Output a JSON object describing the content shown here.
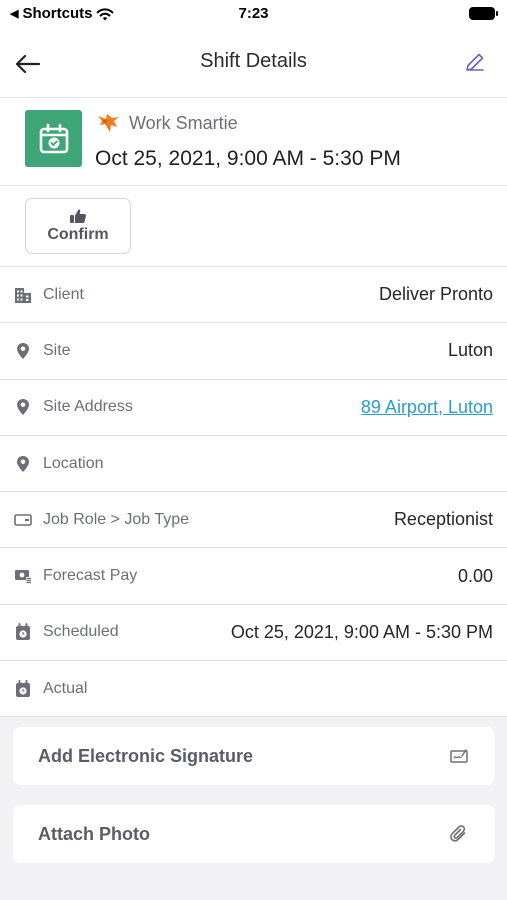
{
  "status_bar": {
    "back_app": "Shortcuts",
    "time": "7:23"
  },
  "nav": {
    "title": "Shift Details",
    "back_icon": "arrow-left-icon",
    "edit_icon": "pencil-icon"
  },
  "shift": {
    "organization": "Work Smartie",
    "time_range": "Oct 25, 2021, 9:00 AM - 5:30 PM",
    "accent_color": "#3ea676"
  },
  "confirm_button": {
    "label": "Confirm",
    "icon": "thumbs-up-icon"
  },
  "details": [
    {
      "label": "Client",
      "value": "Deliver Pronto",
      "icon": "building-icon"
    },
    {
      "label": "Site",
      "value": "Luton",
      "icon": "map-pin-icon"
    },
    {
      "label": "Site Address",
      "value": "89 Airport, Luton",
      "icon": "map-pin-icon"
    },
    {
      "label": "Location",
      "value": "",
      "icon": "map-pin-icon"
    },
    {
      "label": "Job Role > Job Type",
      "value": "Receptionist",
      "icon": "badge-icon"
    },
    {
      "label": "Forecast Pay",
      "value": "0.00",
      "icon": "money-icon"
    },
    {
      "label": "Scheduled",
      "value": "Oct 25, 2021, 9:00 AM - 5:30 PM",
      "icon": "calendar-clock-icon"
    },
    {
      "label": "Actual",
      "value": "",
      "icon": "calendar-clock-icon"
    }
  ],
  "actions": {
    "signature": {
      "label": "Add Electronic Signature",
      "icon": "signature-icon"
    },
    "photo": {
      "label": "Attach Photo",
      "icon": "paperclip-icon"
    }
  },
  "colors": {
    "link": "#2a9fc9",
    "background": "#f2f2f4"
  }
}
